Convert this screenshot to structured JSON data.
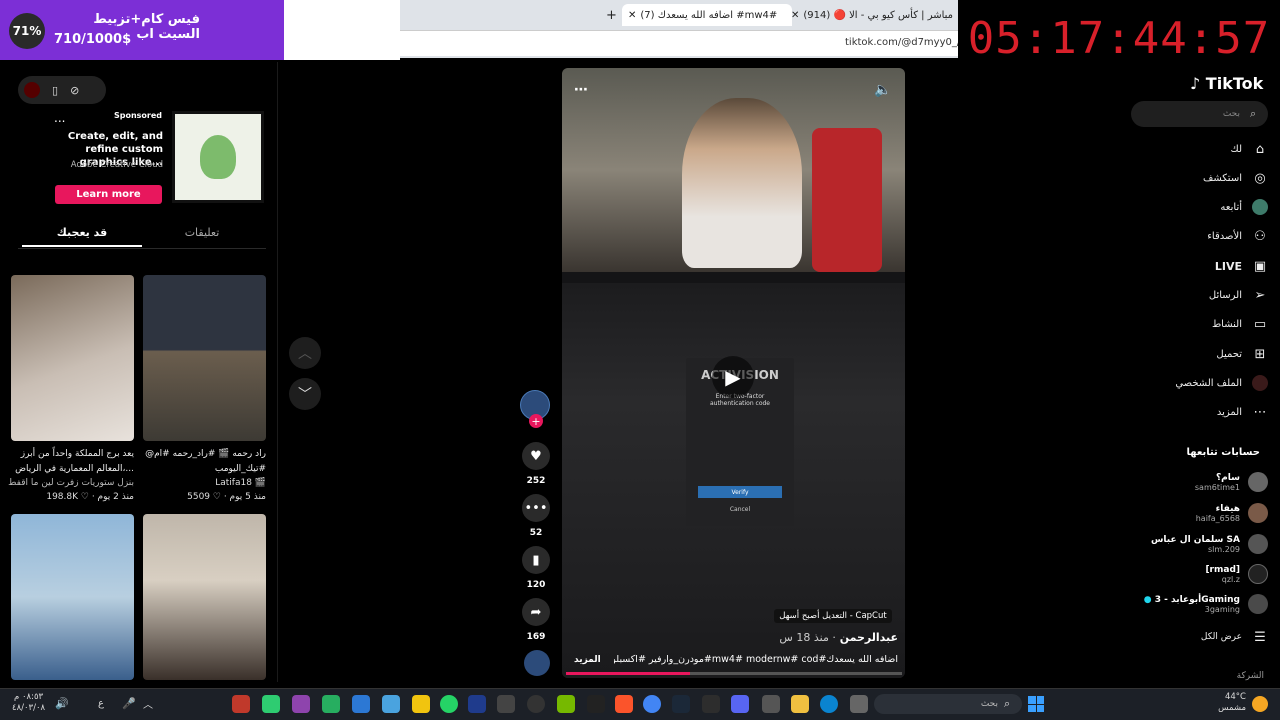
{
  "overlay": {
    "percent": "71%",
    "title": "فيس كام+تزبيط السيت اب",
    "count": "710/1000$",
    "timer": "05:17:44:57"
  },
  "browser": {
    "tabs": [
      {
        "label": "(914) 🔴 مباشر | كأس كيو بي - الا"
      },
      {
        "label": "(7) اضافه الله يسعدك #mw4#"
      }
    ],
    "url": "tiktok.com/@d7myy0_/vide"
  },
  "ad": {
    "more": "...",
    "sponsored": "Sponsored",
    "headline": "Create, edit, and refine custom graphics like...",
    "advertiser": "Adobe Creative Cloud",
    "cta": "Learn more"
  },
  "tabs": {
    "comments": "تعليقات",
    "you_may_like": "قد يعجبك"
  },
  "thumbs": [
    {
      "caption": "يعد برج المملكة واحداً من أبرز المعالم المعمارية في الرياض،...",
      "meta": "198.8K ♡ · منذ 2 يوم",
      "sub": "بنزل ستوريات زفرت لين ما اقفط"
    },
    {
      "caption": "@راد رحمه 🎬 #راد_رحمه #ام #تيك_اليومب",
      "meta": "5509 ♡ · منذ 5 يوم",
      "author": "Latifa18 🎬"
    }
  ],
  "video": {
    "author": "عبدالرحمن",
    "time": "· منذ 18 س",
    "capcut": "CapCut - التعديل أصبح أسهل",
    "caption": "اضافه الله يسعدك#mw4# modernw# cod#مودرن_وارفير #اكسبلور ...",
    "more": "المزيد",
    "act_title": "Enter two-factor authentication code",
    "act_brand": "ACTIVISION",
    "act_verify": "Verify",
    "act_cancel": "Cancel"
  },
  "actions": {
    "likes": "252",
    "comments": "52",
    "saves": "120",
    "shares": "169"
  },
  "nav": {
    "logo": "TikTok",
    "search": "بحث",
    "items": [
      {
        "label": "لك",
        "icon": "home-icon"
      },
      {
        "label": "استكشف",
        "icon": "compass-icon"
      },
      {
        "label": "أتابعه",
        "icon": "following-avatar-icon"
      },
      {
        "label": "الأصدقاء",
        "icon": "friends-icon"
      },
      {
        "label": "LIVE",
        "icon": "live-icon"
      },
      {
        "label": "الرسائل",
        "icon": "send-icon"
      },
      {
        "label": "النشاط",
        "icon": "inbox-icon"
      },
      {
        "label": "تحميل",
        "icon": "plus-icon"
      },
      {
        "label": "الملف الشخصي",
        "icon": "profile-icon"
      },
      {
        "label": "المزيد",
        "icon": "more-icon"
      }
    ],
    "following_title": "حسابات تتابعها",
    "accounts": [
      {
        "name": "سام؟",
        "handle": "sam6time1"
      },
      {
        "name": "هيفاء",
        "handle": "haifa_6568"
      },
      {
        "name": "سلمان ال عباس SA",
        "handle": "slm.209"
      },
      {
        "name": "[rmad]",
        "handle": "qzl.z"
      },
      {
        "name": "أبوعابد - 3Gaming",
        "handle": "3gaming"
      }
    ],
    "see_all": "عرض الكل",
    "company": "الشركة"
  },
  "taskbar": {
    "weather": "44°C",
    "weather_desc": "مشمس",
    "search": "بحث",
    "time": "٠٨:٥٣ م",
    "date": "٤٨/٠٣/٠٨",
    "lang": "ع"
  }
}
